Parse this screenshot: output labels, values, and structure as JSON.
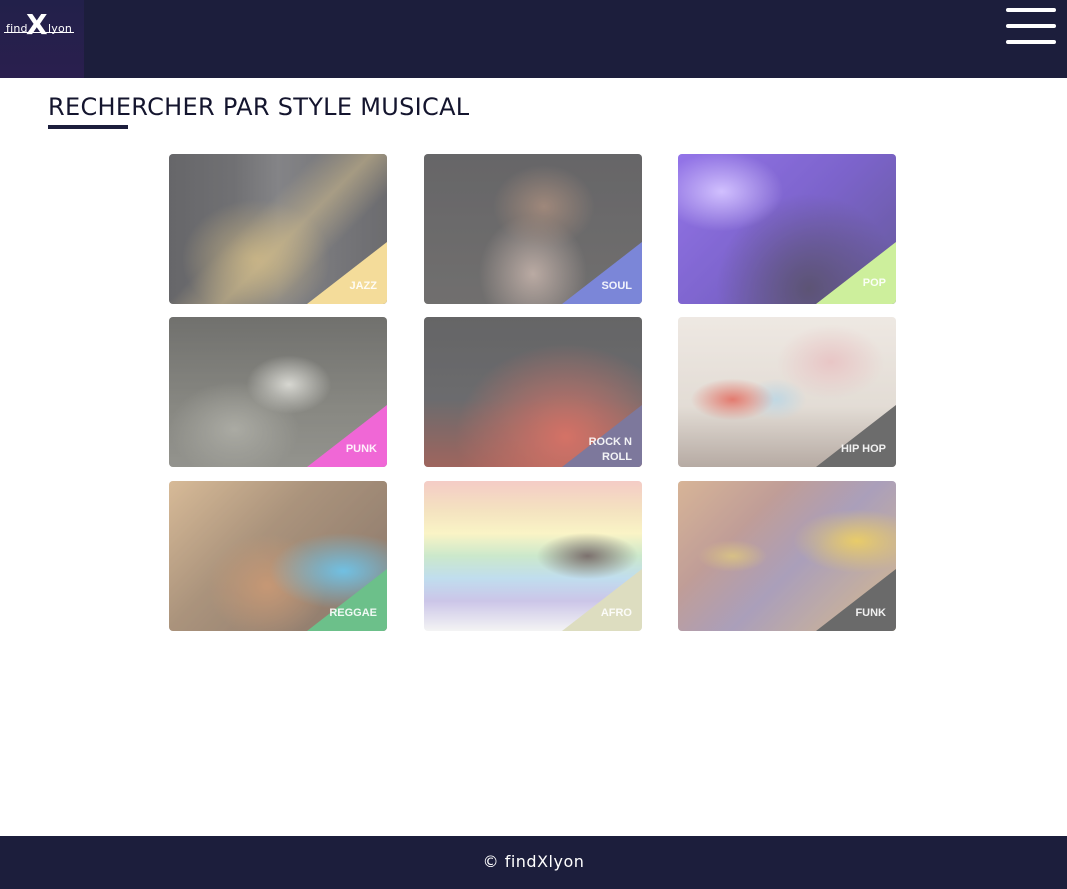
{
  "header": {
    "logo_left": "find",
    "logo_x": "X",
    "logo_right": "lyon",
    "menu_icon": "hamburger-menu-icon"
  },
  "main": {
    "title": "RECHERCHER PAR STYLE MUSICAL",
    "styles": [
      {
        "label": "JAZZ",
        "corner_color": "#f4dc9a"
      },
      {
        "label": "SOUL",
        "corner_color": "#7b86d8"
      },
      {
        "label": "POP",
        "corner_color": "#cdef9c"
      },
      {
        "label": "PUNK",
        "corner_color": "#f067d6"
      },
      {
        "label": "ROCK N ROLL",
        "corner_color": "#7d789c"
      },
      {
        "label": "HIP HOP",
        "corner_color": "#6c6c6c"
      },
      {
        "label": "REGGAE",
        "corner_color": "#6cc08a"
      },
      {
        "label": "AFRO",
        "corner_color": "#ddddc0"
      },
      {
        "label": "FUNK",
        "corner_color": "#6a6a6a"
      }
    ]
  },
  "footer": {
    "copyright": "© findXlyon"
  },
  "colors": {
    "nav_bg": "#1c1e3c",
    "footer_bg": "#1c1e3c",
    "title_text": "#14152e"
  }
}
